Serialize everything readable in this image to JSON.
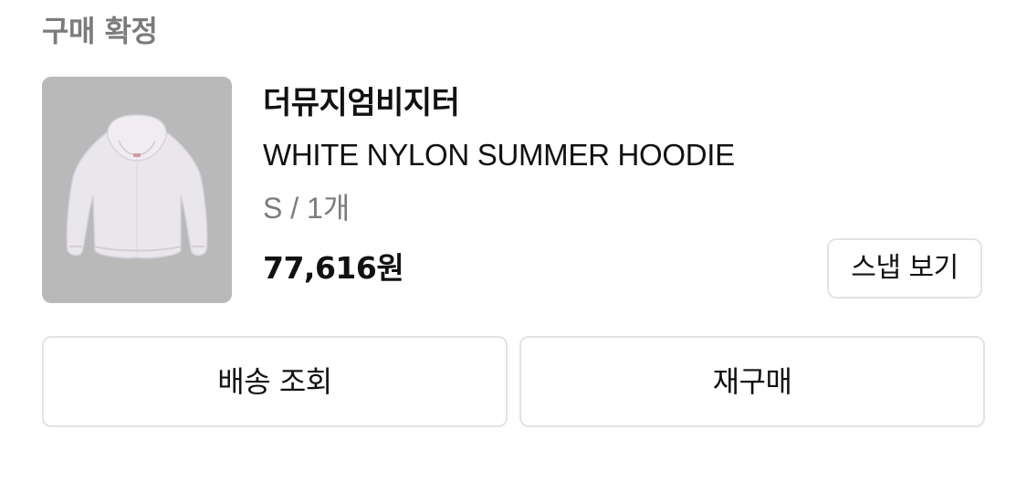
{
  "order": {
    "status": "구매 확정"
  },
  "product": {
    "brand": "더뮤지엄비지터",
    "name": "WHITE NYLON SUMMER HOODIE",
    "option": "S / 1개",
    "price": "77,616원",
    "thumbnail_bg": "#b9b9b9"
  },
  "buttons": {
    "snap": "스냅 보기",
    "shipping": "배송 조회",
    "rebuy": "재구매"
  }
}
